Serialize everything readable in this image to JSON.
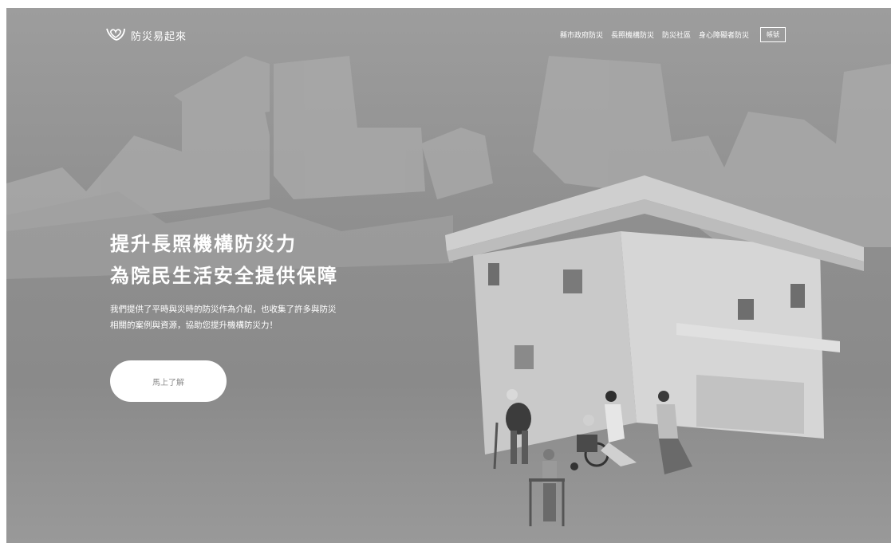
{
  "header": {
    "brand_name": "防災易起來",
    "brand_icon": "hands-heart-logo-icon",
    "nav": [
      {
        "label": "縣市政府防災"
      },
      {
        "label": "長照機構防災"
      },
      {
        "label": "防災社區"
      },
      {
        "label": "身心障礙者防災"
      }
    ],
    "account_label": "帳號"
  },
  "hero": {
    "title_line1": "提升長照機構防災力",
    "title_line2": "為院民生活安全提供保障",
    "desc_line1": "我們提供了平時與災時的防災作為介紹，也收集了許多與防災",
    "desc_line2": "相關的案例與資源，協助您提升機構防災力！",
    "cta_label": "馬上了解"
  },
  "colors": {
    "background": "#8f8f8f",
    "text": "#ffffff",
    "button": "#ffffff",
    "button_text": "#8a8a8a"
  }
}
